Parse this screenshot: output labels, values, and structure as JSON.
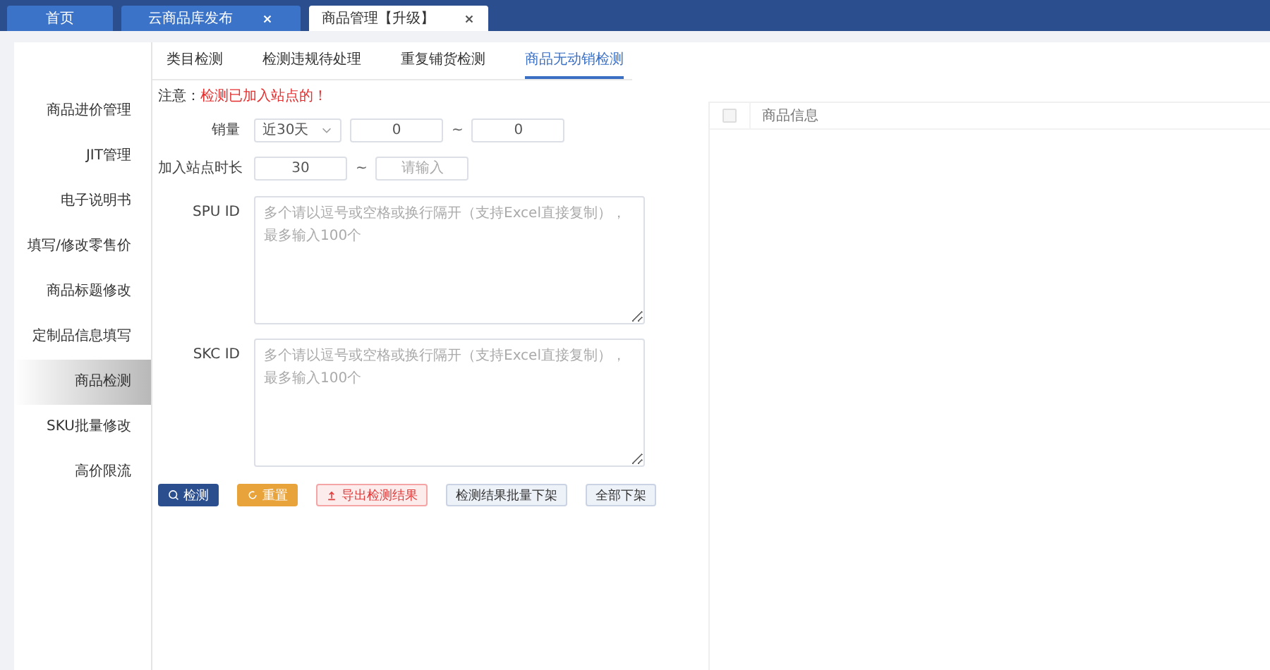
{
  "tabs": [
    {
      "label": "首页",
      "selected": false,
      "closable": false
    },
    {
      "label": "云商品库发布",
      "selected": false,
      "closable": true
    },
    {
      "label": "商品管理【升级】",
      "selected": true,
      "closable": true
    }
  ],
  "sidebar": {
    "items": [
      {
        "label": "商品进价管理",
        "selected": false
      },
      {
        "label": "JIT管理",
        "selected": false
      },
      {
        "label": "电子说明书",
        "selected": false
      },
      {
        "label": "填写/修改零售价",
        "selected": false
      },
      {
        "label": "商品标题修改",
        "selected": false
      },
      {
        "label": "定制品信息填写",
        "selected": false
      },
      {
        "label": "商品检测",
        "selected": true
      },
      {
        "label": "SKU批量修改",
        "selected": false
      },
      {
        "label": "高价限流",
        "selected": false
      }
    ]
  },
  "sub_tabs": [
    {
      "label": "类目检测",
      "selected": false
    },
    {
      "label": "检测违规待处理",
      "selected": false
    },
    {
      "label": "重复铺货检测",
      "selected": false
    },
    {
      "label": "商品无动销检测",
      "selected": true
    }
  ],
  "notice": {
    "label": "注意：",
    "text": "检测已加入站点的！"
  },
  "form": {
    "sales": {
      "label": "销量",
      "period": "近30天",
      "min": "0",
      "separator": "~",
      "max": "0"
    },
    "duration": {
      "label": "加入站点时长",
      "min": "30",
      "separator": "~",
      "max_placeholder": "请输入"
    },
    "spu": {
      "label": "SPU ID",
      "placeholder": "多个请以逗号或空格或换行隔开（支持Excel直接复制），最多输入100个"
    },
    "skc": {
      "label": "SKC ID",
      "placeholder": "多个请以逗号或空格或换行隔开（支持Excel直接复制），最多输入100个"
    }
  },
  "buttons": [
    {
      "label": "检测",
      "kind": "primary"
    },
    {
      "label": "重置",
      "kind": "warning"
    },
    {
      "label": "导出检测结果",
      "kind": "danger"
    },
    {
      "label": "检测结果批量下架",
      "kind": "plain"
    },
    {
      "label": "全部下架",
      "kind": "plain"
    }
  ],
  "table": {
    "select_all_checked": false,
    "columns": [
      "商品信息"
    ]
  }
}
